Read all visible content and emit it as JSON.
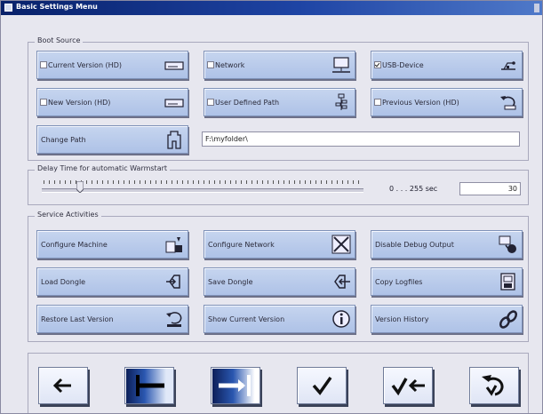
{
  "window": {
    "title": "Basic Settings Menu"
  },
  "boot_source": {
    "label": "Boot Source",
    "options": [
      {
        "label": "Current Version (HD)",
        "checked": false,
        "icon": "hard-drive-icon"
      },
      {
        "label": "Network",
        "checked": false,
        "icon": "network-computer-icon"
      },
      {
        "label": "USB-Device",
        "checked": true,
        "icon": "usb-icon"
      },
      {
        "label": "New Version (HD)",
        "checked": false,
        "icon": "hard-drive-icon"
      },
      {
        "label": "User Defined Path",
        "checked": false,
        "icon": "folder-tree-icon"
      },
      {
        "label": "Previous Version (HD)",
        "checked": false,
        "icon": "undo-disk-icon"
      }
    ],
    "change_path_label": "Change Path",
    "path_value": "F:\\myfolder\\"
  },
  "delay": {
    "label": "Delay Time for automatic Warmstart",
    "range_label": "0 . . . 255 sec",
    "value": "30",
    "slider_min": 0,
    "slider_max": 255,
    "slider_value": 30
  },
  "service": {
    "label": "Service Activities",
    "buttons": [
      {
        "label": "Configure Machine",
        "icon": "configure-machine-icon"
      },
      {
        "label": "Configure Network",
        "icon": "configure-network-icon"
      },
      {
        "label": "Disable Debug Output",
        "icon": "debug-output-icon"
      },
      {
        "label": "Load Dongle",
        "icon": "load-dongle-icon"
      },
      {
        "label": "Save Dongle",
        "icon": "save-dongle-icon"
      },
      {
        "label": "Copy Logfiles",
        "icon": "copy-logfiles-icon"
      },
      {
        "label": "Restore Last Version",
        "icon": "restore-version-icon"
      },
      {
        "label": "Show Current Version",
        "icon": "info-icon"
      },
      {
        "label": "Version History",
        "icon": "chain-icon"
      }
    ]
  },
  "nav": [
    {
      "name": "back",
      "icon": "arrow-left-icon"
    },
    {
      "name": "first",
      "icon": "arrow-to-start-icon"
    },
    {
      "name": "last",
      "icon": "arrow-to-end-icon"
    },
    {
      "name": "ok",
      "icon": "check-icon"
    },
    {
      "name": "ok-back",
      "icon": "check-back-icon"
    },
    {
      "name": "undo",
      "icon": "undo-check-icon"
    }
  ],
  "colors": {
    "title_bar": "#1e44a4",
    "button_blue": "#b8cbec",
    "window_bg": "#e7e7ef"
  }
}
